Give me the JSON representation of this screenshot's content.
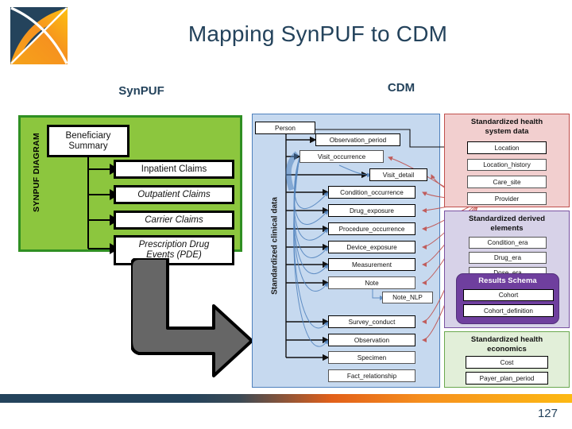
{
  "slide": {
    "title": "Mapping SynPUF to CDM",
    "page_number": "127",
    "accent_navy": "#24435c",
    "accent_orange": "#f6901e"
  },
  "logo": {
    "name": "synpuf-logo",
    "navy": "#24435c",
    "orange": "#f6901e"
  },
  "headers": {
    "left": "SynPUF",
    "right": "CDM"
  },
  "synpuf": {
    "vertical_label": "SYNPUF DIAGRAM",
    "panel_color": "#8cc63e",
    "boxes": [
      {
        "label": "Beneficiary\nSummary",
        "line1": "Beneficiary",
        "line2": "Summary"
      },
      {
        "label": "Inpatient Claims"
      },
      {
        "label": "Outpatient Claims"
      },
      {
        "label": "Carrier Claims"
      },
      {
        "label": "Prescription Drug",
        "line2": "Events (PDE)"
      }
    ]
  },
  "arrow": {
    "name": "big-grey-elbow-arrow",
    "color": "#666666"
  },
  "cdm": {
    "clinical": {
      "vertical_label": "Standardized clinical data",
      "color": "#c6d9ef",
      "tables": [
        "Person",
        "Observation_period",
        "Visit_occurrence",
        "Visit_detail",
        "Condition_occurrence",
        "Drug_exposure",
        "Procedure_occurrence",
        "Device_exposure",
        "Measurement",
        "Note",
        "Note_NLP",
        "Survey_conduct",
        "Observation",
        "Specimen",
        "Fact_relationship"
      ]
    },
    "health_system": {
      "title": "Standardized health system data",
      "title_line1": "Standardized health",
      "title_line2": "system data",
      "color": "#f2cfcf",
      "tables": [
        "Location",
        "Location_history",
        "Care_site",
        "Provider"
      ]
    },
    "derived": {
      "title": "Standardized derived elements",
      "title_line1": "Standardized derived",
      "title_line2": "elements",
      "color": "#d7d2e8",
      "tables": [
        "Condition_era",
        "Drug_era",
        "Dose_era"
      ],
      "results_schema": {
        "title": "Results Schema",
        "color": "#6f3f9e",
        "tables": [
          "Cohort",
          "Cohort_definition"
        ]
      }
    },
    "economics": {
      "title": "Standardized health economics",
      "title_line1": "Standardized health",
      "title_line2": "economics",
      "color": "#e2efd9",
      "tables": [
        "Cost",
        "Payer_plan_period"
      ]
    }
  }
}
